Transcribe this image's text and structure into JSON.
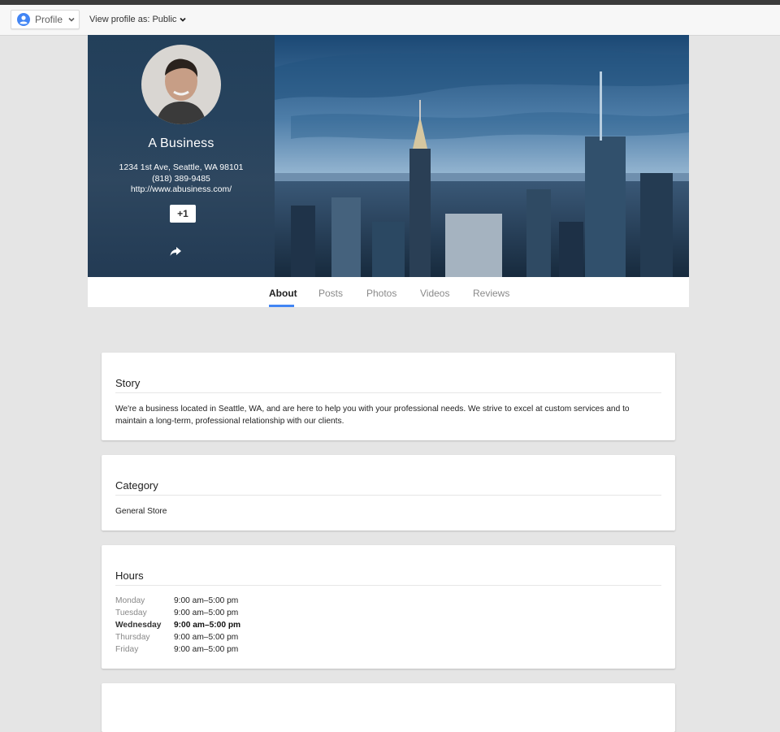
{
  "toolbar": {
    "profile_label": "Profile",
    "view_as_label": "View profile as: Public"
  },
  "business": {
    "name": "A Business",
    "address": "1234 1st Ave, Seattle, WA 98101",
    "phone": "(818) 389-9485",
    "website": "http://www.abusiness.com/",
    "plus_one_label": "+1"
  },
  "tabs": [
    {
      "label": "About",
      "active": true
    },
    {
      "label": "Posts",
      "active": false
    },
    {
      "label": "Photos",
      "active": false
    },
    {
      "label": "Videos",
      "active": false
    },
    {
      "label": "Reviews",
      "active": false
    }
  ],
  "story": {
    "title": "Story",
    "text": "We're a business located in Seattle, WA, and are here to help you with your professional needs. We strive to excel at custom services and to maintain a long-term, professional relationship with our clients."
  },
  "category": {
    "title": "Category",
    "value": "General Store"
  },
  "hours": {
    "title": "Hours",
    "rows": [
      {
        "day": "Monday",
        "time": "9:00 am–5:00 pm"
      },
      {
        "day": "Tuesday",
        "time": "9:00 am–5:00 pm"
      },
      {
        "day": "Wednesday",
        "time": "9:00 am–5:00 pm"
      },
      {
        "day": "Thursday",
        "time": "9:00 am–5:00 pm"
      },
      {
        "day": "Friday",
        "time": "9:00 am–5:00 pm"
      }
    ]
  },
  "colors": {
    "accent": "#4285f4",
    "page_bg": "#e5e5e5"
  },
  "icons": [
    "profile-icon",
    "chevron-down-icon",
    "share-icon"
  ]
}
